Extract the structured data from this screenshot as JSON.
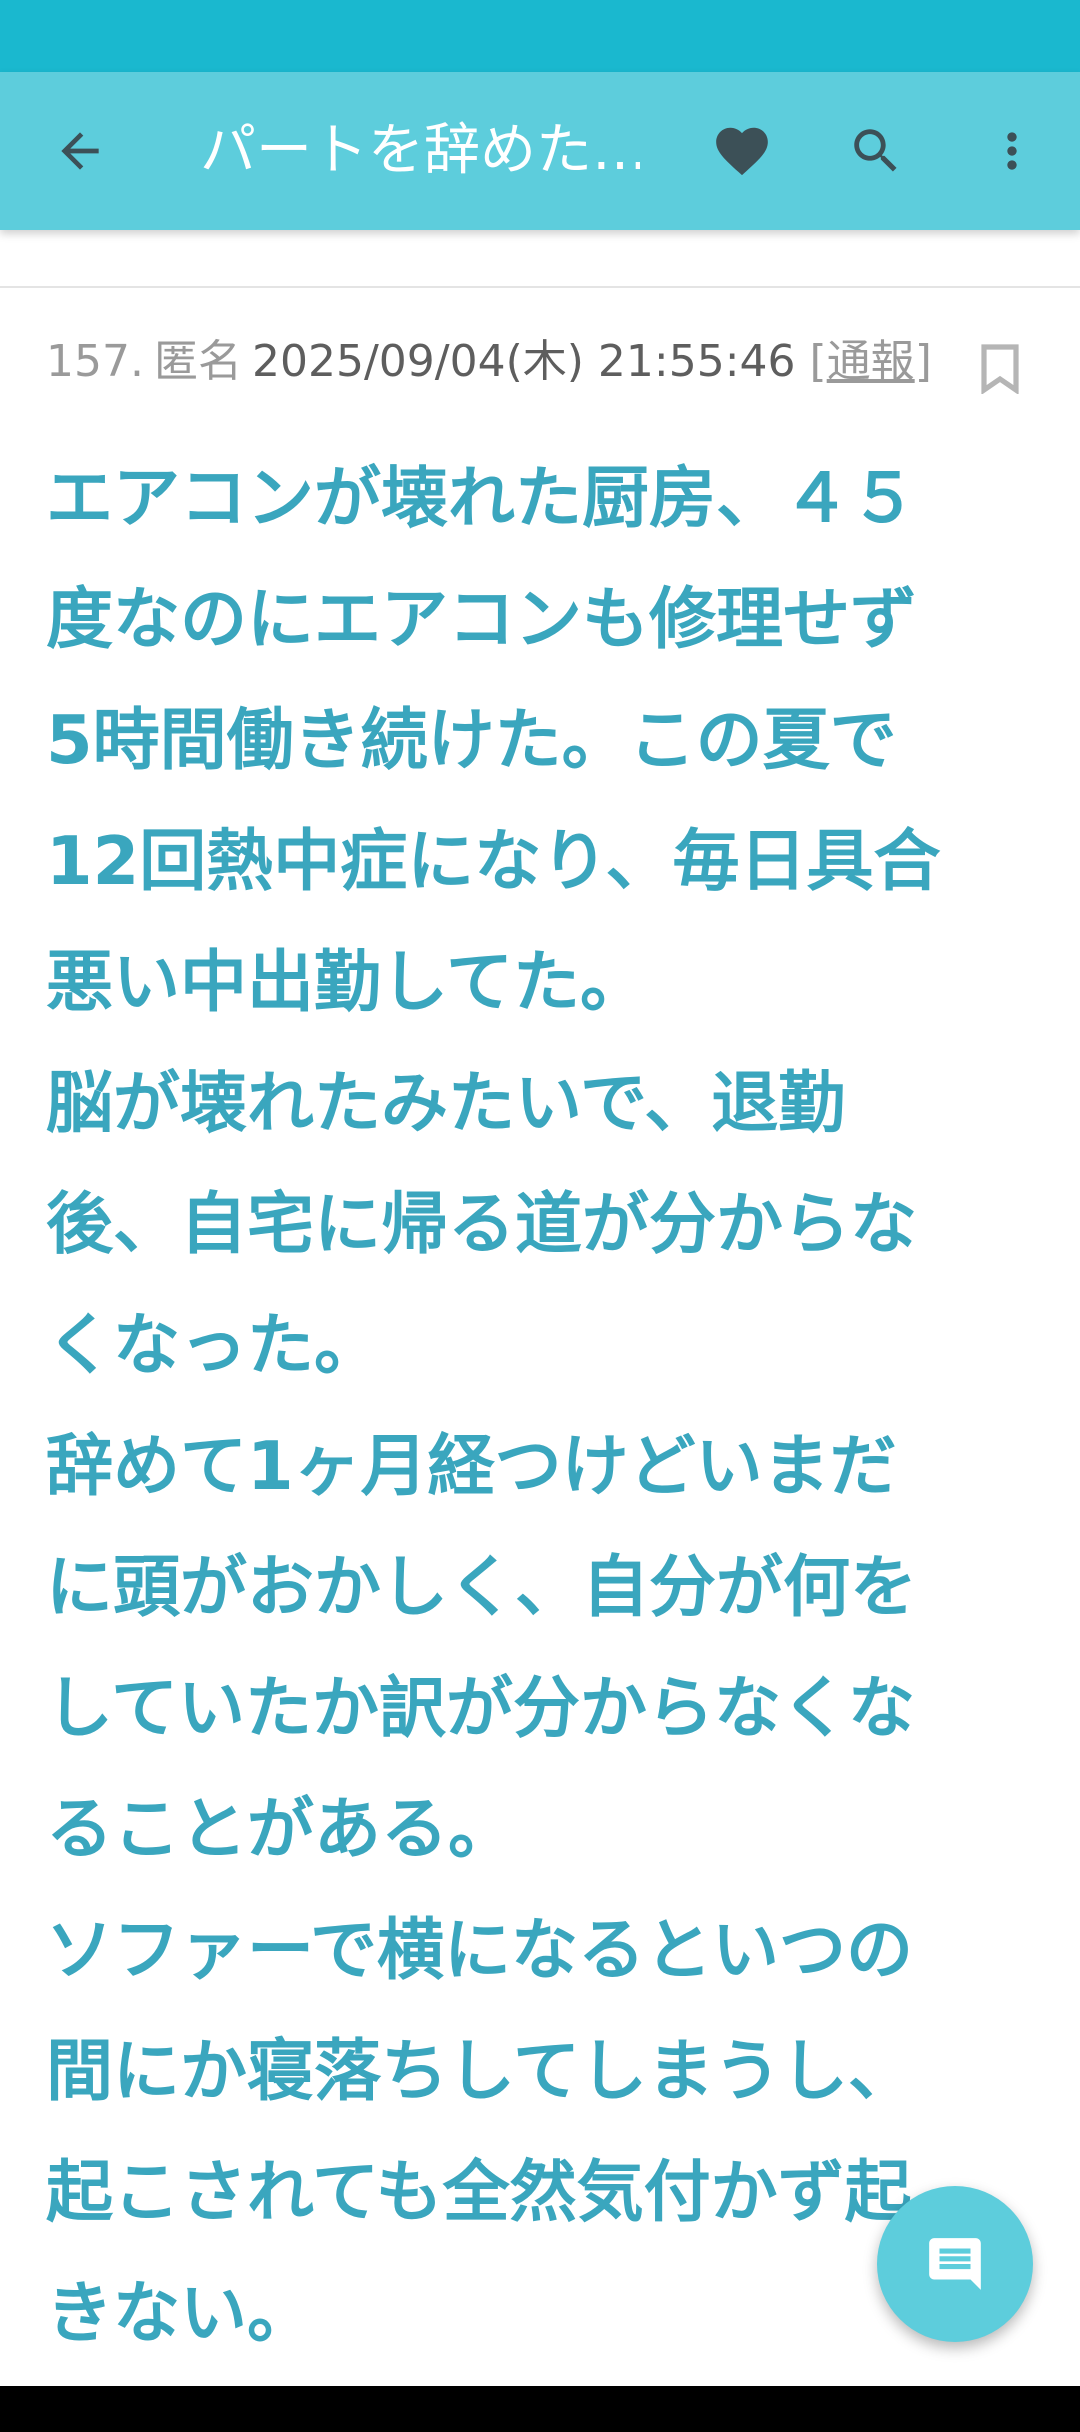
{
  "app_bar": {
    "title": "パートを辞めた…",
    "icons": {
      "back": "arrow-back-icon",
      "favorite": "heart-icon",
      "search": "search-icon",
      "more": "more-vert-icon"
    }
  },
  "post": {
    "number": "157.",
    "author": "匿名",
    "datetime": "2025/09/04(木) 21:55:46",
    "report_open": "[",
    "report_label": "通報",
    "report_close": "]",
    "bookmark_icon": "bookmark-outline-icon",
    "body_lines": [
      "エアコンが壊れた厨房、４５",
      "度なのにエアコンも修理せず",
      "5時間働き続けた。この夏で",
      "12回熱中症になり、毎日具合",
      "悪い中出勤してた。",
      "脳が壊れたみたいで、退勤",
      "後、自宅に帰る道が分からな",
      "くなった。",
      "辞めて1ヶ月経つけどいまだ",
      "に頭がおかしく、自分が何を",
      "していたか訳が分からなくな",
      "ることがある。",
      "ソファーで横になるといつの",
      "間にか寝落ちしてしまうし、",
      "起こされても全然気付かず起",
      "きない。"
    ]
  },
  "fab": {
    "icon": "comment-icon"
  },
  "colors": {
    "status_bar": "#1ab8cf",
    "app_bar": "#5dcddc",
    "body_text": "#3aa6be",
    "meta_text": "#9a9a9a"
  }
}
